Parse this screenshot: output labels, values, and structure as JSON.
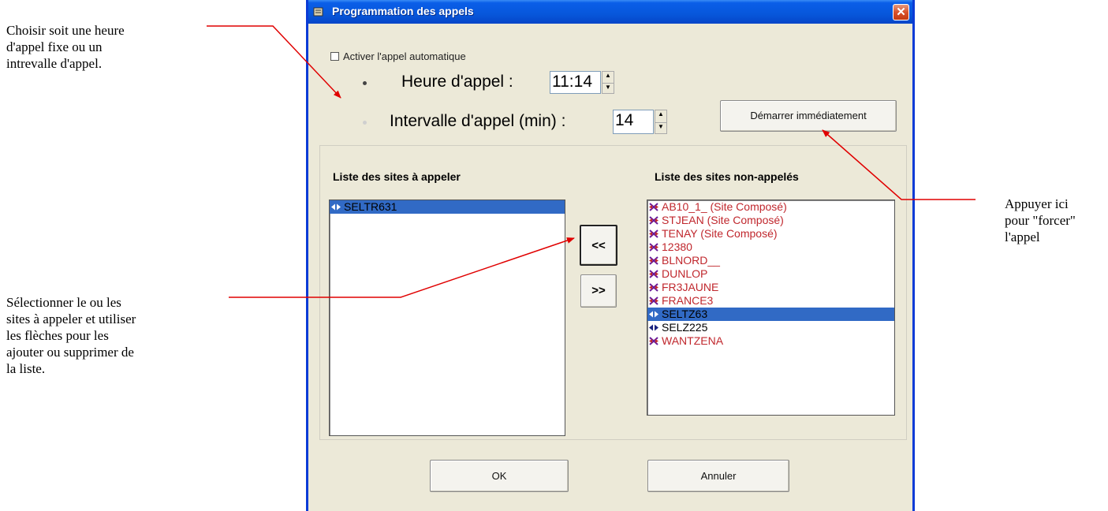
{
  "window": {
    "title": "Programmation des appels",
    "close_label": "✕"
  },
  "options": {
    "auto_call_label": "Activer l'appel automatique",
    "auto_call_checked": false,
    "call_time_label": "Heure d'appel :",
    "call_time_value": "11:14",
    "call_time_selected": true,
    "interval_label": "Intervalle d'appel (min) :",
    "interval_value": "14",
    "interval_selected": false,
    "start_now_label": "Démarrer immédiatement"
  },
  "lists": {
    "to_call": {
      "title": "Liste des sites à appeler",
      "items": [
        {
          "label": "SELTR631",
          "icon": "connected-icon",
          "color": "black",
          "selected": true
        }
      ]
    },
    "not_called": {
      "title": "Liste des sites non-appelés",
      "items": [
        {
          "label": "AB10_1_ (Site Composé)",
          "icon": "disconnected-icon",
          "color": "red",
          "selected": false
        },
        {
          "label": "STJEAN (Site Composé)",
          "icon": "disconnected-icon",
          "color": "red",
          "selected": false
        },
        {
          "label": "TENAY (Site Composé)",
          "icon": "disconnected-icon",
          "color": "red",
          "selected": false
        },
        {
          "label": "12380",
          "icon": "disconnected-icon",
          "color": "red",
          "selected": false
        },
        {
          "label": "BLNORD__",
          "icon": "disconnected-icon",
          "color": "red",
          "selected": false
        },
        {
          "label": "DUNLOP",
          "icon": "disconnected-icon",
          "color": "red",
          "selected": false
        },
        {
          "label": "FR3JAUNE",
          "icon": "disconnected-icon",
          "color": "red",
          "selected": false
        },
        {
          "label": "FRANCE3",
          "icon": "disconnected-icon",
          "color": "red",
          "selected": false
        },
        {
          "label": "SELTZ63",
          "icon": "connected-icon",
          "color": "black",
          "selected": true
        },
        {
          "label": "SELZ225",
          "icon": "connected-icon",
          "color": "black",
          "selected": false
        },
        {
          "label": "WANTZENA",
          "icon": "disconnected-icon",
          "color": "red",
          "selected": false
        }
      ]
    },
    "add_label": "<<",
    "remove_label": ">>"
  },
  "footer": {
    "ok_label": "OK",
    "cancel_label": "Annuler"
  },
  "annotations": {
    "note1": [
      "Choisir soit une heure",
      "d'appel fixe ou un",
      "intrevalle d'appel."
    ],
    "note2": [
      "Sélectionner le ou les",
      "sites à appeler et utiliser",
      "les flèches pour les",
      "ajouter ou supprimer de",
      "la liste."
    ],
    "note3": [
      "Appuyer ici",
      "pour \"forcer\"",
      "l'appel"
    ]
  },
  "colors": {
    "titlebar": "#0757db",
    "selection": "#316ac5",
    "red_text": "#c0272d",
    "annotation_line": "#e00000"
  }
}
